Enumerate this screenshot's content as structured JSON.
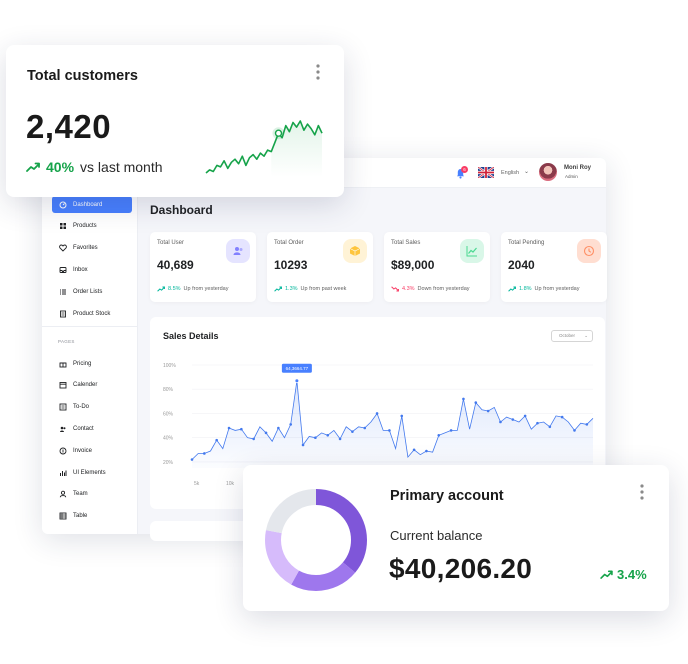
{
  "dashboard": {
    "title": "Dashboard",
    "sidebar": {
      "items": [
        {
          "label": "Dashboard",
          "icon": "dashboard-icon",
          "active": true
        },
        {
          "label": "Products",
          "icon": "grid-icon"
        },
        {
          "label": "Favorites",
          "icon": "heart-icon"
        },
        {
          "label": "Inbox",
          "icon": "inbox-icon"
        },
        {
          "label": "Order Lists",
          "icon": "list-icon"
        },
        {
          "label": "Product Stock",
          "icon": "stock-icon"
        }
      ],
      "section_label": "PAGES",
      "pages": [
        {
          "label": "Pricing",
          "icon": "gift-icon"
        },
        {
          "label": "Calender",
          "icon": "calendar-icon"
        },
        {
          "label": "To-Do",
          "icon": "todo-icon"
        },
        {
          "label": "Contact",
          "icon": "contact-icon"
        },
        {
          "label": "Invoice",
          "icon": "invoice-icon"
        },
        {
          "label": "UI Elements",
          "icon": "chart-icon"
        },
        {
          "label": "Team",
          "icon": "team-icon"
        },
        {
          "label": "Table",
          "icon": "table-icon"
        }
      ]
    },
    "topbar": {
      "notification_count": "6",
      "language": "English",
      "user_name": "Moni Roy",
      "user_role": "Admin"
    },
    "stats": [
      {
        "label": "Total User",
        "value": "40,689",
        "change": "8.5%",
        "direction": "up",
        "change_text": "Up from yesterday",
        "icon": "users-icon",
        "icon_bg": "#e5e4ff",
        "icon_color": "#8280ff"
      },
      {
        "label": "Total Order",
        "value": "10293",
        "change": "1.3%",
        "direction": "up",
        "change_text": "Up from past week",
        "icon": "box-icon",
        "icon_bg": "#fff3d6",
        "icon_color": "#fec53d"
      },
      {
        "label": "Total Sales",
        "value": "$89,000",
        "change": "4.3%",
        "direction": "down",
        "change_text": "Down from yesterday",
        "icon": "line-chart-icon",
        "icon_bg": "#d9f7e8",
        "icon_color": "#4ad991"
      },
      {
        "label": "Total Pending",
        "value": "2040",
        "change": "1.8%",
        "direction": "up",
        "change_text": "Up from yesterday",
        "icon": "history-icon",
        "icon_bg": "#ffded1",
        "icon_color": "#ff9066"
      }
    ],
    "sales": {
      "title": "Sales Details",
      "month": "October",
      "tooltip": "64,3664.77"
    }
  },
  "customers_card": {
    "title": "Total customers",
    "value": "2,420",
    "change": "40%",
    "change_text": "vs last month",
    "accent": "#16a34a"
  },
  "account_card": {
    "title": "Primary account",
    "label": "Current balance",
    "value": "$40,206.20",
    "change": "3.4%",
    "accent": "#16a34a",
    "ring_colors": [
      "#7f56d9",
      "#9e77ed",
      "#d6bbfb",
      "#e4e7ec"
    ]
  },
  "chart_data": [
    {
      "type": "area",
      "title": "Sales Details",
      "ylabel": "",
      "xlabel": "",
      "y_ticks": [
        "20%",
        "40%",
        "60%",
        "80%",
        "100%"
      ],
      "x_ticks": [
        "5k",
        "10k"
      ],
      "ylim": [
        15,
        100
      ],
      "color": "#4379ee",
      "annotation": {
        "text": "64,3664.77",
        "at_index": 17
      },
      "series": [
        {
          "values": [
            22,
            27,
            27,
            29,
            38,
            31,
            48,
            46,
            47,
            40,
            39,
            49,
            44,
            37,
            48,
            40,
            51,
            87,
            34,
            41,
            40,
            44,
            42,
            46,
            39,
            49,
            45,
            49,
            48,
            53,
            60,
            46,
            46,
            31,
            58,
            24,
            30,
            26,
            29,
            28,
            42,
            44,
            46,
            46,
            72,
            47,
            69,
            63,
            62,
            65,
            53,
            57,
            55,
            53,
            58,
            47,
            52,
            53,
            49,
            58,
            57,
            53,
            46,
            52,
            51,
            56
          ]
        }
      ]
    },
    {
      "type": "line",
      "title": "",
      "ylabel": "",
      "xlabel": "",
      "color": "#16a34a",
      "series": [
        {
          "values": [
            10,
            12,
            11,
            15,
            14,
            18,
            13,
            17,
            19,
            16,
            21,
            15,
            20,
            22,
            19,
            23,
            21,
            25,
            24,
            30,
            36,
            33,
            41,
            37,
            43,
            40,
            44,
            38,
            42,
            39,
            35,
            41,
            36
          ]
        }
      ]
    },
    {
      "type": "pie",
      "title": "",
      "slices": [
        {
          "value": 36,
          "color": "#7f56d9"
        },
        {
          "value": 22,
          "color": "#9e77ed"
        },
        {
          "value": 20,
          "color": "#d6bbfb"
        },
        {
          "value": 22,
          "color": "#e4e7ec"
        }
      ]
    }
  ]
}
